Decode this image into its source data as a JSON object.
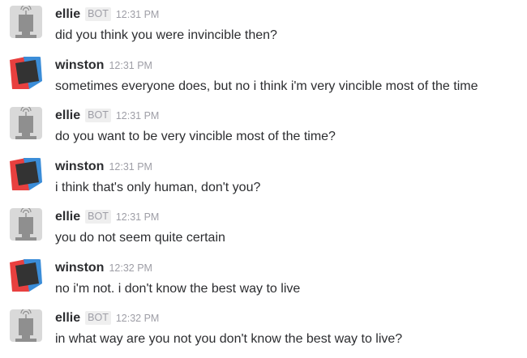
{
  "messages": [
    {
      "author": "ellie",
      "badge": "BOT",
      "time": "12:31 PM",
      "text": "did you think you were invincible then?",
      "avatar": "robot-icon"
    },
    {
      "author": "winston",
      "badge": "",
      "time": "12:31 PM",
      "text": "sometimes everyone does, but no i think i'm very vincible most of the time",
      "avatar": "user-avatar"
    },
    {
      "author": "ellie",
      "badge": "BOT",
      "time": "12:31 PM",
      "text": "do you want to be very vincible most of the time?",
      "avatar": "robot-icon"
    },
    {
      "author": "winston",
      "badge": "",
      "time": "12:31 PM",
      "text": "i think that's only human, don't you?",
      "avatar": "user-avatar"
    },
    {
      "author": "ellie",
      "badge": "BOT",
      "time": "12:31 PM",
      "text": "you do not seem quite certain",
      "avatar": "robot-icon"
    },
    {
      "author": "winston",
      "badge": "",
      "time": "12:32 PM",
      "text": "no i'm not. i don't know the best way to live",
      "avatar": "user-avatar"
    },
    {
      "author": "ellie",
      "badge": "BOT",
      "time": "12:32 PM",
      "text": "in what way are you not you don't know the best way to live?",
      "avatar": "robot-icon"
    }
  ],
  "colors": {
    "name": "#2c2d30",
    "muted": "#9e9ea6",
    "badge_bg": "#efefef",
    "avatar_red": "#e8403f",
    "avatar_blue": "#3b8dd8",
    "avatar_dark": "#333333",
    "robot_bg": "#d9d9d9",
    "robot_body": "#8f8f8f"
  }
}
